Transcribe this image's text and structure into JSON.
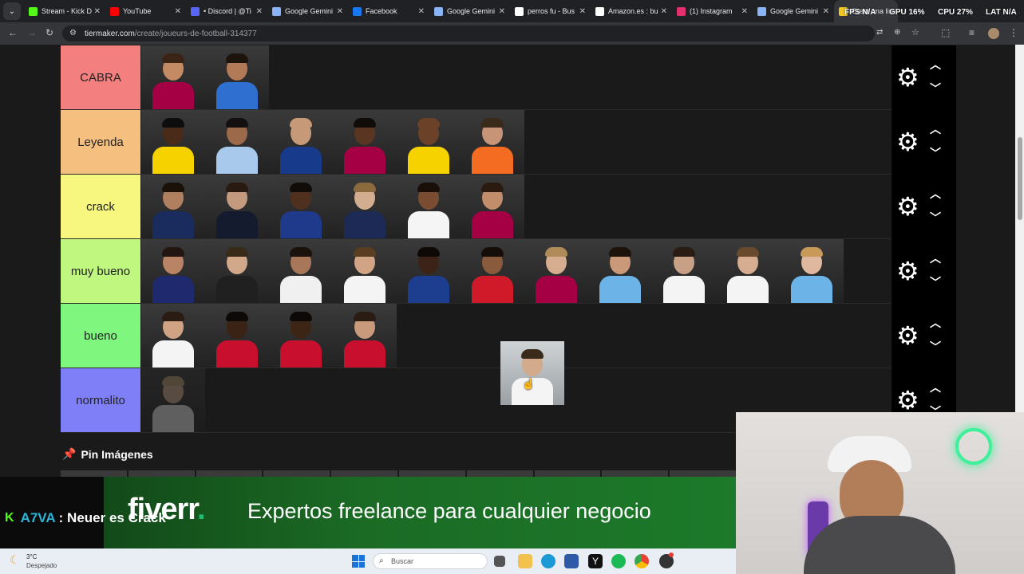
{
  "browser": {
    "tabs": [
      {
        "label": "Stream - Kick D",
        "icon": "kick-icon",
        "color": "#53fc18"
      },
      {
        "label": "YouTube",
        "icon": "youtube-icon",
        "color": "#ff0000"
      },
      {
        "label": "• Discord | @Ti",
        "icon": "discord-icon",
        "color": "#5865f2"
      },
      {
        "label": "Google Gemini",
        "icon": "gemini-icon",
        "color": "#8ab4f8"
      },
      {
        "label": "Facebook",
        "icon": "facebook-icon",
        "color": "#1877f2"
      },
      {
        "label": "Google Gemini",
        "icon": "gemini-icon",
        "color": "#8ab4f8"
      },
      {
        "label": "perros fu - Bus",
        "icon": "google-icon",
        "color": "#ffffff"
      },
      {
        "label": "Amazon.es : bu",
        "icon": "amazon-icon",
        "color": "#ffffff"
      },
      {
        "label": "(1) Instagram",
        "icon": "instagram-icon",
        "color": "#e1306c"
      },
      {
        "label": "Google Gemini",
        "icon": "gemini-icon",
        "color": "#8ab4f8"
      },
      {
        "label": "Crear una list",
        "icon": "tiermaker-icon",
        "color": "#f3c623"
      }
    ],
    "url_host": "tiermaker.com",
    "url_path": "/create/joueurs-de-football-314377"
  },
  "overlay_stats": {
    "fps_label": "FPS",
    "fps_value": "N/A",
    "gpu_label": "GPU",
    "gpu_value": "16%",
    "cpu_label": "CPU",
    "cpu_value": "27%",
    "lat_label": "LAT",
    "lat_value": "N/A"
  },
  "tiers": [
    {
      "label": "CABRA",
      "color": "#f47f7f",
      "items": [
        {
          "shirt": "#a50044",
          "skin": "#c48a63",
          "hair": "#3b2416"
        },
        {
          "shirt": "#2f6fcf",
          "skin": "#b37a57",
          "hair": "#1d140e"
        }
      ]
    },
    {
      "label": "Leyenda",
      "color": "#f5bf7f",
      "items": [
        {
          "shirt": "#f6d200",
          "skin": "#4a2a18",
          "hair": "#0d0d0d"
        },
        {
          "shirt": "#a8c8ec",
          "skin": "#9c6a4a",
          "hair": "#151010"
        },
        {
          "shirt": "#173a8a",
          "skin": "#c69a78",
          "hair": "#c69a78"
        },
        {
          "shirt": "#a50044",
          "skin": "#5a3622",
          "hair": "#120c08"
        },
        {
          "shirt": "#f6d200",
          "skin": "#6b4128",
          "hair": "#6b4128"
        },
        {
          "shirt": "#f36c21",
          "skin": "#c89478",
          "hair": "#3a2a1a"
        }
      ]
    },
    {
      "label": "crack",
      "color": "#f7f77f",
      "items": [
        {
          "shirt": "#1a2b5e",
          "skin": "#b07f5f",
          "hair": "#1a1208"
        },
        {
          "shirt": "#141b2e",
          "skin": "#c39a7e",
          "hair": "#281a10"
        },
        {
          "shirt": "#1f3a8a",
          "skin": "#4f301e",
          "hair": "#120c08"
        },
        {
          "shirt": "#1d2a55",
          "skin": "#d3ad8f",
          "hair": "#8b6a3e"
        },
        {
          "shirt": "#f5f5f5",
          "skin": "#7a4d32",
          "hair": "#1a0f08"
        },
        {
          "shirt": "#a50044",
          "skin": "#c28d6a",
          "hair": "#2a1a10"
        }
      ]
    },
    {
      "label": "muy bueno",
      "color": "#c0f77f",
      "items": [
        {
          "shirt": "#1f2a6e",
          "skin": "#b98466",
          "hair": "#231610"
        },
        {
          "shirt": "#202020",
          "skin": "#d2a88a",
          "hair": "#3a2a18"
        },
        {
          "shirt": "#f0f0f0",
          "skin": "#a8775a",
          "hair": "#1b120c"
        },
        {
          "shirt": "#f4f4f4",
          "skin": "#d0a485",
          "hair": "#5a3e22"
        },
        {
          "shirt": "#1d3d8f",
          "skin": "#3b2417",
          "hair": "#0e0906"
        },
        {
          "shirt": "#d01a2a",
          "skin": "#8a5a3c",
          "hair": "#140d08"
        },
        {
          "shirt": "#a50044",
          "skin": "#d6ad8f",
          "hair": "#b08b5a"
        },
        {
          "shirt": "#6cb4e8",
          "skin": "#c9997a",
          "hair": "#1d130b"
        },
        {
          "shirt": "#f4f4f4",
          "skin": "#c8a086",
          "hair": "#2a1c12"
        },
        {
          "shirt": "#f4f4f4",
          "skin": "#d6ad90",
          "hair": "#6a4a2c"
        },
        {
          "shirt": "#6cb4e8",
          "skin": "#e0b8a0",
          "hair": "#c89a5a"
        }
      ]
    },
    {
      "label": "bueno",
      "color": "#7ff77f",
      "items": [
        {
          "shirt": "#f4f4f4",
          "skin": "#cfa384",
          "hair": "#2a1c12"
        },
        {
          "shirt": "#c8102e",
          "skin": "#3a2314",
          "hair": "#0d0906"
        },
        {
          "shirt": "#c8102e",
          "skin": "#3d2516",
          "hair": "#0d0906"
        },
        {
          "shirt": "#c8102e",
          "skin": "#c99a7c",
          "hair": "#2a1c12"
        }
      ]
    },
    {
      "label": "normalito",
      "color": "#7f7ff7",
      "items": [
        {
          "shirt": "#e0e0e0",
          "skin": "#c9a88e",
          "hair": "#b79a74",
          "faded": true
        }
      ]
    }
  ],
  "dragging_item": {
    "shirt": "#f4f4f4",
    "skin": "#d2aa8c",
    "hair": "#3a2a1a"
  },
  "pin_section": {
    "title": "Pin Imágenes"
  },
  "ad": {
    "brand": "fiverr",
    "brand_dot": ".",
    "tagline": "Expertos freelance para cualquier negocio"
  },
  "chat": {
    "user": "A7VA",
    "message": ": Neuer es Crack"
  },
  "taskbar": {
    "weather_temp": "3°C",
    "weather_desc": "Despejado",
    "search_placeholder": "Buscar"
  }
}
